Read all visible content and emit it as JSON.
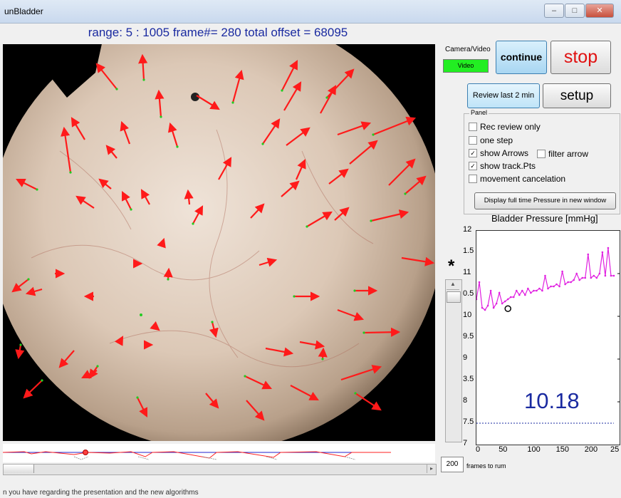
{
  "window": {
    "title": "unBladder",
    "min_label": "–",
    "max_label": "□",
    "close_label": "✕"
  },
  "header": {
    "range_text": "range:  5 :  1005  frame#= 280 total offset = 68095"
  },
  "controls": {
    "camera_video_label": "Camera/Video",
    "video_indicator": "Video",
    "continue_label": "continue",
    "stop_label": "stop",
    "review_label": "Review last 2 min",
    "setup_label": "setup"
  },
  "panel": {
    "legend": "Panel",
    "options": [
      {
        "label": "Rec review only",
        "checked": false
      },
      {
        "label": "one step",
        "checked": false
      },
      {
        "label": "show Arrows",
        "checked": true
      },
      {
        "label": "filter arrow",
        "checked": false
      },
      {
        "label": "show track.Pts",
        "checked": true
      },
      {
        "label": "movement cancelation",
        "checked": false
      }
    ],
    "display_button": "Display full time Pressure in new window"
  },
  "plot": {
    "title": "Bladder Pressure [mmHg]",
    "y_ticks": [
      "12",
      "1.5",
      "11",
      "0.5",
      "10",
      "9.5",
      "9",
      "3.5",
      "8",
      "7.5",
      "7"
    ],
    "x_ticks": [
      "0",
      "50",
      "100",
      "150",
      "200",
      "25"
    ],
    "current_value": "10.18",
    "colors": {
      "trace": "#e020e0",
      "reference": "#1a2aa0"
    }
  },
  "chart_data": {
    "type": "line",
    "title": "Bladder Pressure [mmHg]",
    "xlabel": "",
    "ylabel": "",
    "xlim": [
      0,
      250
    ],
    "ylim": [
      7,
      12
    ],
    "x": [
      0,
      5,
      10,
      15,
      20,
      25,
      30,
      35,
      40,
      45,
      50,
      55,
      60,
      65,
      70,
      75,
      80,
      85,
      90,
      95,
      100,
      105,
      110,
      115,
      120,
      125,
      130,
      135,
      140,
      145,
      150,
      155,
      160,
      165,
      170,
      175,
      180,
      185,
      190,
      195,
      200,
      205,
      210,
      215,
      220,
      225,
      230,
      235,
      240
    ],
    "series": [
      {
        "values": [
          10.4,
          10.8,
          10.2,
          10.15,
          10.25,
          10.6,
          10.2,
          10.3,
          10.55,
          10.3,
          10.35,
          10.4,
          10.45,
          10.45,
          10.6,
          10.5,
          10.6,
          10.5,
          10.65,
          10.55,
          10.6,
          10.6,
          10.65,
          10.6,
          10.95,
          10.65,
          10.7,
          10.7,
          10.75,
          10.7,
          11.05,
          10.75,
          10.8,
          10.8,
          10.85,
          11.0,
          10.85,
          10.9,
          10.9,
          11.45,
          10.9,
          10.95,
          10.9,
          11.0,
          11.5,
          10.95,
          11.6,
          10.95,
          10.95
        ]
      },
      {
        "values": [
          7.5,
          7.5,
          7.5,
          7.5,
          7.5,
          7.5,
          7.5,
          7.5,
          7.5,
          7.5,
          7.5,
          7.5,
          7.5,
          7.5,
          7.5,
          7.5,
          7.5,
          7.5,
          7.5,
          7.5,
          7.5,
          7.5,
          7.5,
          7.5,
          7.5,
          7.5,
          7.5,
          7.5,
          7.5,
          7.5,
          7.5,
          7.5,
          7.5,
          7.5,
          7.5,
          7.5,
          7.5,
          7.5,
          7.5,
          7.5,
          7.5,
          7.5,
          7.5,
          7.5,
          7.5,
          7.5,
          7.5,
          7.5,
          7.5
        ]
      }
    ],
    "marker": {
      "x": 55,
      "y": 10.18
    },
    "grid": false
  },
  "footer": {
    "frames_value": "200",
    "frames_label": "frames to rum",
    "bottom_text": "n you have regarding the presentation and the new algorithms"
  }
}
